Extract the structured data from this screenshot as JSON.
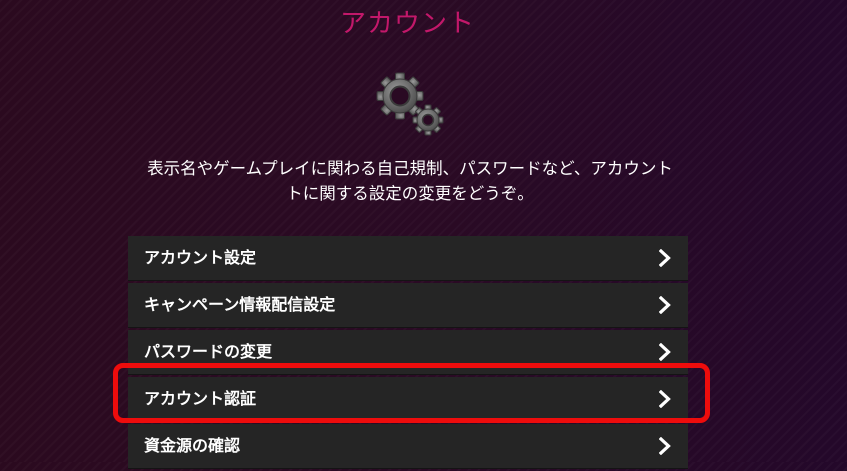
{
  "header": {
    "title": "アカウント"
  },
  "hero": {
    "icon": "gears-icon",
    "description_line1": "表示名やゲームプレイに関わる自己規制、パスワードなど、アカウント",
    "description_line2": "トに関する設定の変更をどうぞ。"
  },
  "menu": {
    "items": [
      {
        "label": "アカウント設定",
        "icon": "chevron-right-icon"
      },
      {
        "label": "キャンペーン情報配信設定",
        "icon": "chevron-right-icon"
      },
      {
        "label": "パスワードの変更",
        "icon": "chevron-right-icon"
      },
      {
        "label": "アカウント認証",
        "icon": "chevron-right-icon",
        "highlighted": true
      },
      {
        "label": "資金源の確認",
        "icon": "chevron-right-icon"
      }
    ]
  },
  "colors": {
    "title": "#c2186a",
    "highlight": "#ee0c0c",
    "item_background": "#252525"
  }
}
